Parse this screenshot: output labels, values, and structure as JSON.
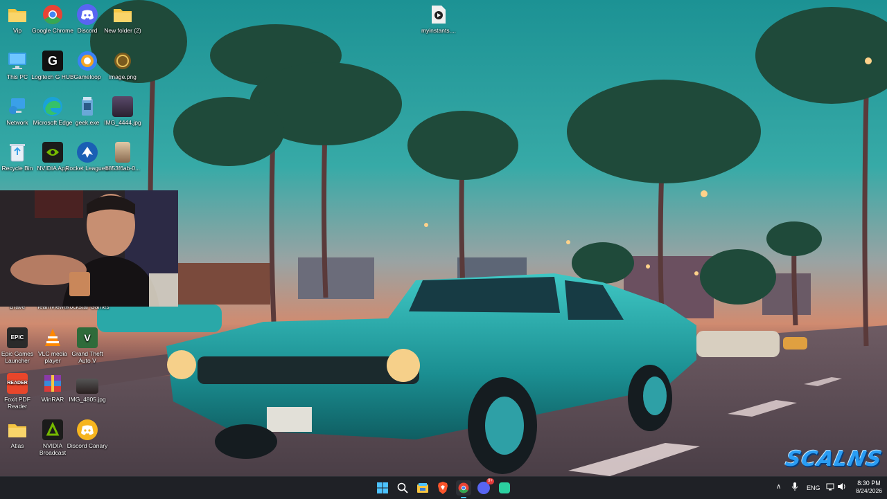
{
  "desktop": {
    "icons": [
      {
        "label": "Vip",
        "icon": "folder-icon",
        "color": "#f5c542"
      },
      {
        "label": "Google Chrome",
        "icon": "chrome-icon",
        "color": "#e94335"
      },
      {
        "label": "Discord",
        "icon": "discord-icon",
        "color": "#5865f2"
      },
      {
        "label": "New folder (2)",
        "icon": "folder-icon",
        "color": "#f5c542"
      },
      {
        "label": "This PC",
        "icon": "monitor-icon",
        "color": "#3aa0e8"
      },
      {
        "label": "Logitech G HUB",
        "icon": "logitech-icon",
        "color": "#111111"
      },
      {
        "label": "Gameloop",
        "icon": "gameloop-icon",
        "color": "#3b82f6"
      },
      {
        "label": "image.png",
        "icon": "image-icon",
        "color": "#7a5a1e"
      },
      {
        "label": "Network",
        "icon": "network-icon",
        "color": "#3aa0e8"
      },
      {
        "label": "Microsoft Edge",
        "icon": "edge-icon",
        "color": "#1aa2d8"
      },
      {
        "label": "geek.exe",
        "icon": "geek-icon",
        "color": "#6aa8d8"
      },
      {
        "label": "IMG_4444.jpg",
        "icon": "photo-icon",
        "color": "#4a3a5a"
      },
      {
        "label": "Recycle Bin",
        "icon": "recycle-bin-icon",
        "color": "#e8f0f8"
      },
      {
        "label": "NVIDIA App",
        "icon": "nvidia-icon",
        "color": "#76b900"
      },
      {
        "label": "Rocket League®",
        "icon": "rocket-league-icon",
        "color": "#1a5fb4"
      },
      {
        "label": "b853f6ab-0...",
        "icon": "photo-icon",
        "color": "#c9a27a"
      },
      {
        "label": "Brave",
        "icon": "brave-icon",
        "color": "#fb542b"
      },
      {
        "label": "TeamViewer",
        "icon": "teamviewer-icon",
        "color": "#0e8ee9"
      },
      {
        "label": "Rockstar Games",
        "icon": "rockstar-icon",
        "color": "#fcaf17"
      },
      {
        "label": "Epic Games Launcher",
        "icon": "epic-games-icon",
        "color": "#2a2a2a"
      },
      {
        "label": "VLC media player",
        "icon": "vlc-icon",
        "color": "#ff8800"
      },
      {
        "label": "Grand Theft Auto V",
        "icon": "gta-icon",
        "color": "#2f6b3a"
      },
      {
        "label": "Foxit PDF Reader",
        "icon": "foxit-icon",
        "color": "#e8462b"
      },
      {
        "label": "WinRAR",
        "icon": "winrar-icon",
        "color": "#8a3aa8"
      },
      {
        "label": "IMG_4805.jpg",
        "icon": "photo-icon",
        "color": "#3a2a2a"
      },
      {
        "label": "Atlas",
        "icon": "folder-icon",
        "color": "#f5c542"
      },
      {
        "label": "NVIDIA Broadcast",
        "icon": "nvidia-broadcast-icon",
        "color": "#1b1b1b"
      },
      {
        "label": "Discord Canary",
        "icon": "discord-canary-icon",
        "color": "#f6b51e"
      },
      {
        "label": "myinstants....",
        "icon": "media-file-icon",
        "color": "#f0f0f0"
      }
    ]
  },
  "taskbar": {
    "icons": [
      "start-icon",
      "search-icon",
      "file-explorer-icon",
      "brave-icon",
      "chrome-icon",
      "discord-icon",
      "app-icon"
    ],
    "discord_badge": "9+",
    "language": "ENG",
    "time": "8:30 PM",
    "date": "8/24/2026"
  },
  "watermark": {
    "text": "SCALNS"
  }
}
